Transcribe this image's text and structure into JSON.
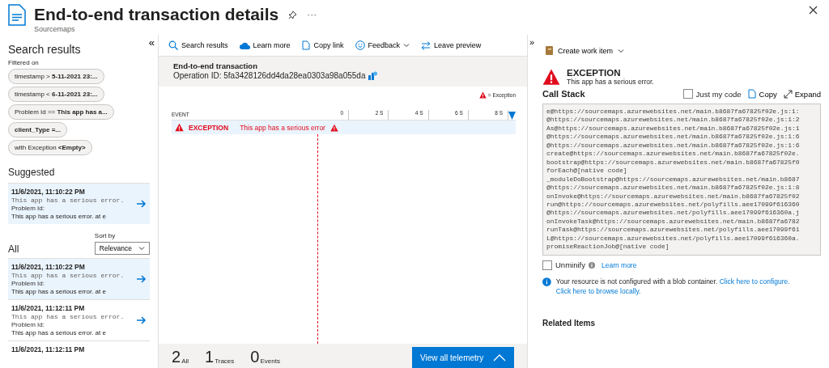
{
  "header": {
    "title": "End-to-end transaction details",
    "subtitle": "Sourcemaps",
    "more": "···"
  },
  "search_panel": {
    "collapse": "«",
    "title": "Search results",
    "filtered_label": "Filtered on",
    "filters": [
      "timestamp > **5-11-2021 23:...**",
      "timestamp < **6-11-2021 23:...**",
      "Problem Id == **This app has a...**",
      "**client_Type =...**",
      "with Exception **<Empty>**"
    ],
    "suggested_title": "Suggested",
    "suggested": [
      {
        "time": "11/6/2021, 11:10:22 PM",
        "message": "This app has a serious error.",
        "problem_label": "Problem Id:",
        "problem": "This app has a serious error. at e",
        "selected": true
      }
    ],
    "all_title": "All",
    "sort_label": "Sort by",
    "sort_value": "Relevance",
    "all": [
      {
        "time": "11/6/2021, 11:10:22 PM",
        "message": "This app has a serious error.",
        "problem_label": "Problem Id:",
        "problem": "This app has a serious error. at e",
        "selected": true
      },
      {
        "time": "11/6/2021, 11:12:11 PM",
        "message": "This app has a serious error.",
        "problem_label": "Problem Id:",
        "problem": "This app has a serious error. at e",
        "selected": false
      },
      {
        "time": "11/6/2021, 11:12:11 PM",
        "selected": false
      }
    ]
  },
  "toolbar": [
    {
      "label": "Search results",
      "kind": "search"
    },
    {
      "label": "Learn more",
      "kind": "cloud"
    },
    {
      "label": "Copy link",
      "kind": "copy"
    },
    {
      "label": "Feedback",
      "kind": "feedback"
    },
    {
      "label": "Leave preview",
      "kind": "swap"
    }
  ],
  "transaction": {
    "title": "End-to-end transaction",
    "operation": "Operation ID: 5fa3428126dd4da28ea0303a98a055da",
    "legend": "= Exception",
    "event_header": "EVENT",
    "ticks": [
      "0",
      "2 S",
      "4 S",
      "6 S",
      "8 S"
    ],
    "events": [
      {
        "type": "EXCEPTION",
        "message": "This app has a serious error",
        "selected": true
      }
    ]
  },
  "footer": {
    "counts": [
      {
        "value": "2",
        "label": "All"
      },
      {
        "value": "1",
        "label": "Traces"
      },
      {
        "value": "0",
        "label": "Events"
      }
    ],
    "button": "View all telemetry"
  },
  "details": {
    "expand_panel": "»",
    "create_work_item": "Create work item",
    "exception_type": "EXCEPTION",
    "exception_message": "This app has a serious error.",
    "call_stack_title": "Call Stack",
    "just_my_code": {
      "label": "Just my code",
      "checked": false
    },
    "copy": "Copy",
    "expand": "Expand",
    "stack": [
      "e@https://sourcemaps.azurewebsites.net/main.b8687fa67825f02e.js:1:",
      "@https://sourcemaps.azurewebsites.net/main.b8687fa67825f02e.js:1:2",
      "As@https://sourcemaps.azurewebsites.net/main.b8687fa67825f02e.js:1",
      "@https://sourcemaps.azurewebsites.net/main.b8687fa67825f02e.js:1:6",
      "@https://sourcemaps.azurewebsites.net/main.b8687fa67825f02e.js:1:6",
      "create@https://sourcemaps.azurewebsites.net/main.b8687fa67825f02e.",
      "bootstrap@https://sourcemaps.azurewebsites.net/main.b8687fa67825f0",
      "forEach@[native code]",
      "_moduleDoBootstrap@https://sourcemaps.azurewebsites.net/main.b8687",
      "@https://sourcemaps.azurewebsites.net/main.b8687fa67825f02e.js:1:8",
      "onInvoke@https://sourcemaps.azurewebsites.net/main.b8687fa67825f02",
      "run@https://sourcemaps.azurewebsites.net/polyfills.aee17099f616360",
      "@https://sourcemaps.azurewebsites.net/polyfills.aee17099f616360a.j",
      "onInvokeTask@https://sourcemaps.azurewebsites.net/main.b8687fa6782",
      "runTask@https://sourcemaps.azurewebsites.net/polyfills.aee17099f61",
      "L@https://sourcemaps.azurewebsites.net/polyfills.aee17099f616360a.",
      "promiseReactionJob@[native code]"
    ],
    "unminify": {
      "label": "Unminify",
      "checked": false
    },
    "unminify_link": "Learn more",
    "info_text": "Your resource is not configured with a blob container.",
    "info_link_1": "Click here to configure.",
    "info_link_2": "Click here to browse locally.",
    "related_title": "Related Items"
  }
}
